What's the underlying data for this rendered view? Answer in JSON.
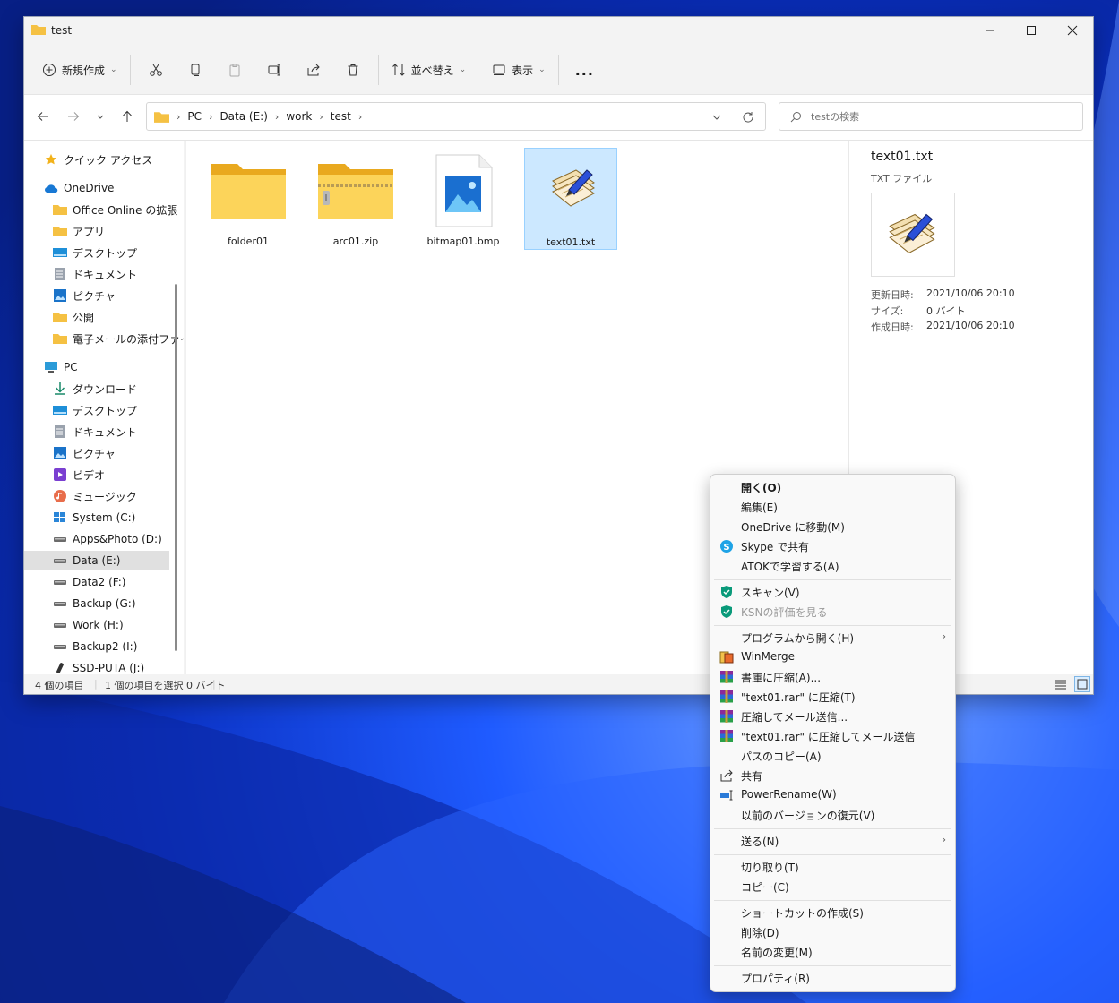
{
  "window": {
    "title": "test",
    "controls": [
      "minimize-icon",
      "maximize-icon",
      "close-icon"
    ]
  },
  "toolbar": {
    "new_label": "新規作成",
    "sort_label": "並べ替え",
    "view_label": "表示",
    "more_label": "..."
  },
  "address": {
    "crumbs": [
      "PC",
      "Data (E:)",
      "work",
      "test"
    ]
  },
  "search": {
    "placeholder": "testの検索"
  },
  "nav": {
    "items": [
      "クイック アクセス",
      "OneDrive",
      "Office Online の拡張",
      "アプリ",
      "デスクトップ",
      "ドキュメント",
      "ピクチャ",
      "公開",
      "電子メールの添付ファイ",
      "PC",
      "ダウンロード",
      "デスクトップ",
      "ドキュメント",
      "ピクチャ",
      "ビデオ",
      "ミュージック",
      "System (C:)",
      "Apps&Photo (D:)",
      "Data (E:)",
      "Data2 (F:)",
      "Backup (G:)",
      "Work (H:)",
      "Backup2 (I:)",
      "SSD-PUTA (J:)"
    ]
  },
  "files": [
    {
      "name": "folder01",
      "type": "folder"
    },
    {
      "name": "arc01.zip",
      "type": "zip"
    },
    {
      "name": "bitmap01.bmp",
      "type": "image"
    },
    {
      "name": "text01.txt",
      "type": "text",
      "selected": true
    }
  ],
  "details": {
    "name": "text01.txt",
    "type": "TXT ファイル",
    "props": [
      {
        "label": "更新日時:",
        "value": "2021/10/06 20:10"
      },
      {
        "label": "サイズ:",
        "value": "0 バイト"
      },
      {
        "label": "作成日時:",
        "value": "2021/10/06 20:10"
      }
    ]
  },
  "status": {
    "count": "4 個の項目",
    "selected": "1 個の項目を選択  0 バイト"
  },
  "menu": {
    "items": [
      {
        "label": "開く(O)",
        "bold": true
      },
      {
        "label": "編集(E)"
      },
      {
        "label": "OneDrive に移動(M)"
      },
      {
        "label": "Skype で共有",
        "icon": "skype-icon"
      },
      {
        "label": "ATOKで学習する(A)"
      },
      {
        "label": "スキャン(V)",
        "icon": "kaspersky-shield-icon"
      },
      {
        "label": "KSNの評価を見る",
        "icon": "kaspersky-shield-icon",
        "disabled": true
      },
      {
        "label": "プログラムから開く(H)",
        "submenu": true
      },
      {
        "label": "WinMerge",
        "icon": "winmerge-icon"
      },
      {
        "label": "書庫に圧縮(A)...",
        "icon": "winrar-icon"
      },
      {
        "label": "\"text01.rar\" に圧縮(T)",
        "icon": "winrar-icon"
      },
      {
        "label": "圧縮してメール送信...",
        "icon": "winrar-icon"
      },
      {
        "label": "\"text01.rar\" に圧縮してメール送信",
        "icon": "winrar-icon"
      },
      {
        "label": "パスのコピー(A)"
      },
      {
        "label": "共有",
        "icon": "share-icon"
      },
      {
        "label": "PowerRename(W)",
        "icon": "powerrename-icon"
      },
      {
        "label": "以前のバージョンの復元(V)"
      },
      {
        "label": "送る(N)",
        "submenu": true
      },
      {
        "label": "切り取り(T)"
      },
      {
        "label": "コピー(C)"
      },
      {
        "label": "ショートカットの作成(S)"
      },
      {
        "label": "削除(D)"
      },
      {
        "label": "名前の変更(M)"
      },
      {
        "label": "プロパティ(R)"
      }
    ]
  }
}
